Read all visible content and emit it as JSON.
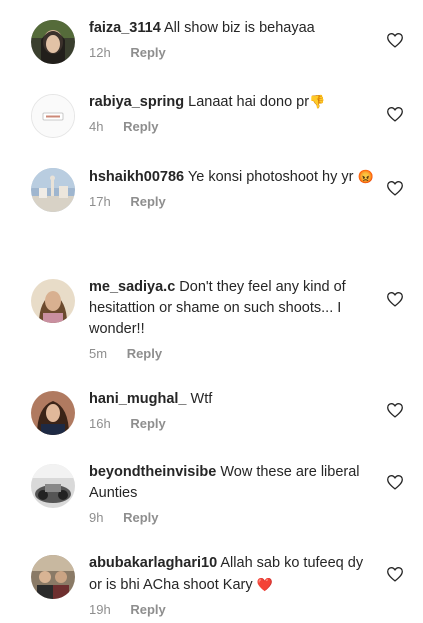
{
  "comments": [
    {
      "username": "faiza_3114",
      "text": "All show biz is behayaa",
      "emoji": "",
      "time": "12h",
      "reply_label": "Reply",
      "avatar_icon": "user-avatar-icon"
    },
    {
      "username": "rabiya_spring",
      "text": "Lanaat hai dono pr",
      "emoji": "👎",
      "time": "4h",
      "reply_label": "Reply",
      "avatar_icon": "user-avatar-icon"
    },
    {
      "username": "hshaikh00786",
      "text": "Ye konsi photoshoot hy yr",
      "emoji": "😡",
      "time": "17h",
      "reply_label": "Reply",
      "avatar_icon": "user-avatar-icon"
    },
    {
      "username": "me_sadiya.c",
      "text": "Don't they feel any kind of hesitattion or shame on such shoots... I wonder!!",
      "emoji": "",
      "time": "5m",
      "reply_label": "Reply",
      "avatar_icon": "user-avatar-icon"
    },
    {
      "username": "hani_mughal_",
      "text": "Wtf",
      "emoji": "",
      "time": "16h",
      "reply_label": "Reply",
      "avatar_icon": "user-avatar-icon"
    },
    {
      "username": "beyondtheinvisibe",
      "text": "Wow these are liberal Aunties",
      "emoji": "",
      "time": "9h",
      "reply_label": "Reply",
      "avatar_icon": "user-avatar-icon"
    },
    {
      "username": "abubakarlaghari10",
      "text": "Allah sab ko tufeeq dy or is bhi ACha shoot Kary",
      "emoji": "❤️",
      "time": "19h",
      "reply_label": "Reply",
      "avatar_icon": "user-avatar-icon"
    }
  ],
  "icons": {
    "like": "heart-outline-icon"
  },
  "colors": {
    "text": "#262626",
    "meta": "#8e8e8e",
    "heart_stroke": "#262626"
  }
}
